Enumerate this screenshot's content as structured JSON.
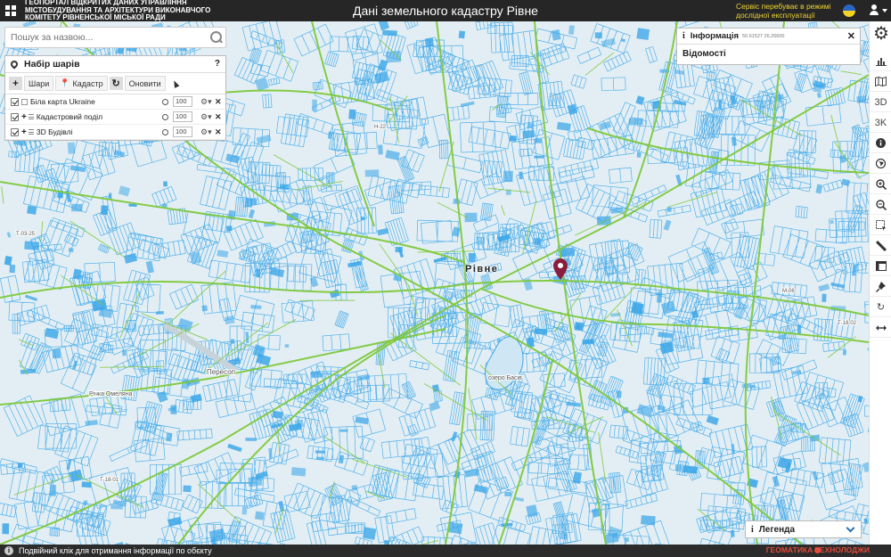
{
  "header": {
    "org_name": "Геопортал відкритих даних управління містобудування та архітектури виконавчого комітету Рівненської міської ради",
    "title": "Дані земельного кадастру Рівне",
    "beta_notice": "Сервіс перебуває в режимі дослідної експлуатації",
    "flag_colors": [
      "#2a64c5",
      "#f5d223"
    ]
  },
  "search": {
    "placeholder": "Пошук за назвою..."
  },
  "layers_panel": {
    "title": "Набір шарів",
    "help": "?",
    "toolbar": {
      "add": "+",
      "layers_label": "Шари",
      "cadastre_label": "Кадастр",
      "refresh_label": "Оновити"
    },
    "layers": [
      {
        "name": "Біла карта Ukraine",
        "opacity": "100",
        "checked": true
      },
      {
        "name": "Кадастровий поділ",
        "opacity": "100",
        "checked": true
      },
      {
        "name": "3D Будівлі",
        "opacity": "100",
        "checked": true
      }
    ]
  },
  "info_panel": {
    "title": "Інформація",
    "coords": "50.61527 26.26600",
    "body": "Відомості"
  },
  "map": {
    "city_label": "Рівне",
    "lake_label": "озеро Басів",
    "place_label": "Пересоп",
    "river_label": "Річка Омеляна",
    "road_labels": [
      "Т-03-25",
      "М-06",
      "Н-22",
      "Т-18-01",
      "Т-18-02"
    ],
    "parcel_color": "#3aa6e8",
    "road_color": "#7ec83b"
  },
  "toolbar_right": {
    "buttons": [
      "chart-icon",
      "map-icon",
      "3D",
      "3K",
      "info-icon",
      "globe-icon",
      "zoom-in-icon",
      "zoom-out-icon",
      "select-icon",
      "ruler-icon",
      "frame-icon",
      "pin-icon",
      "refresh-icon",
      "resize-icon"
    ]
  },
  "legend": {
    "title": "Легенда"
  },
  "status": {
    "hint": "Подвійний клік для отримання інформації по обєкту",
    "brand": "ГЕОМАТИКА ТЕХНОЛОДЖИ"
  }
}
